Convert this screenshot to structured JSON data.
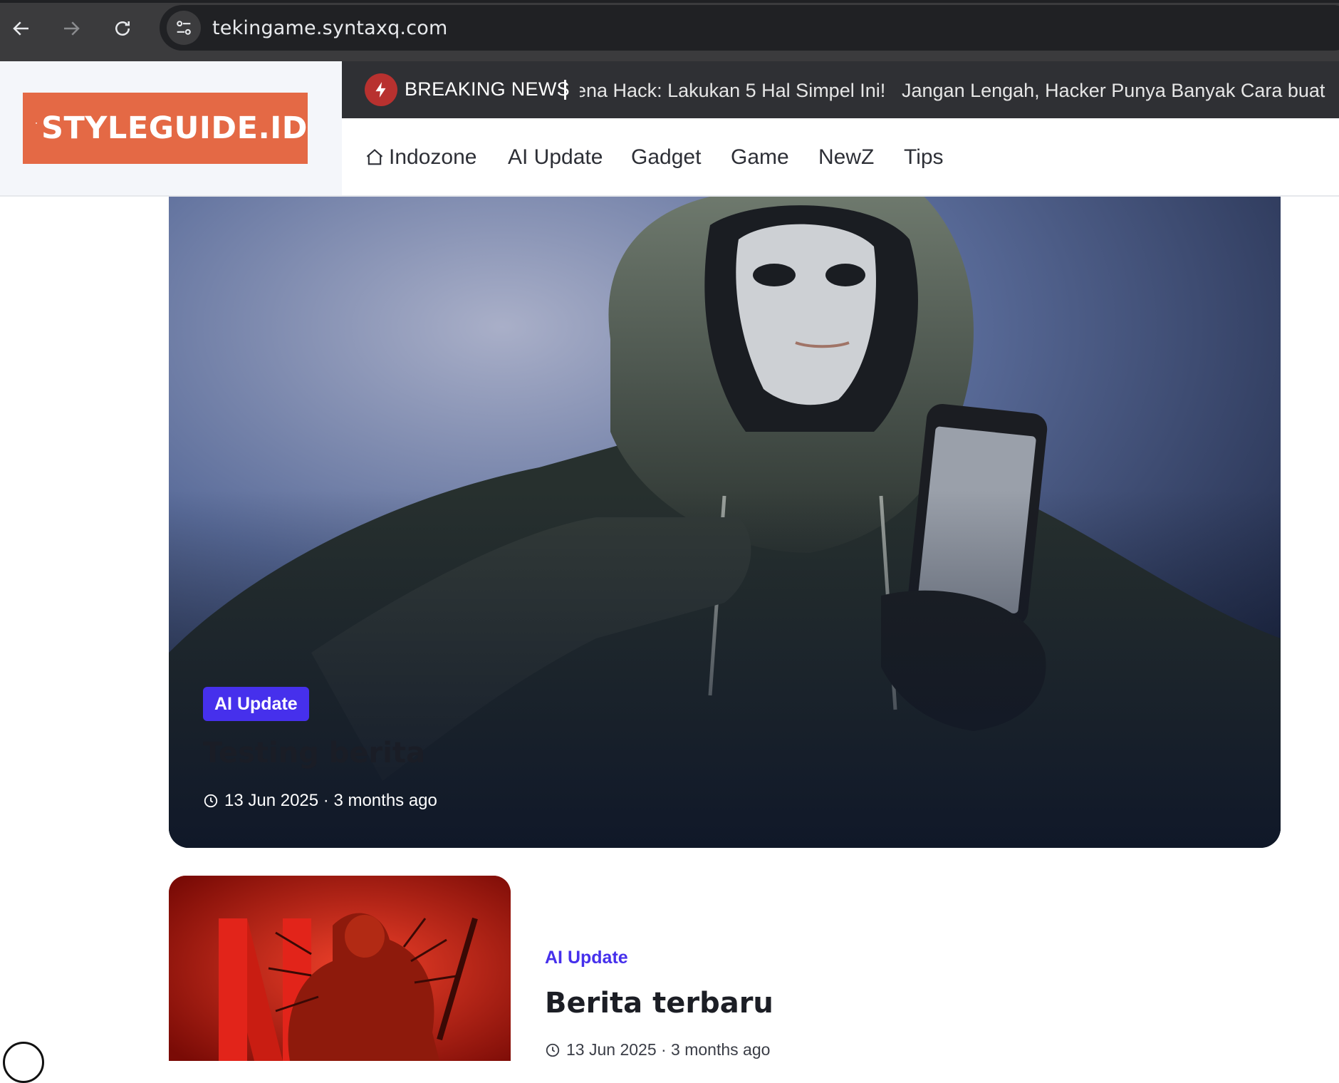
{
  "browser": {
    "url": "tekingame.syntaxq.com",
    "icons": [
      "back-arrow-icon",
      "forward-arrow-icon",
      "reload-icon",
      "site-info-icon"
    ]
  },
  "site": {
    "logo_text": "STYLEGUIDE.ID",
    "brand_color": "#e46945",
    "accent_color": "#4630ec"
  },
  "ticker": {
    "label": "BREAKING NEWS",
    "items": [
      "ena Hack: Lakukan 5 Hal Simpel Ini!",
      "Jangan Lengah, Hacker Punya Banyak Cara buat"
    ]
  },
  "menu": {
    "items": [
      "Indozone",
      "AI Update",
      "Gadget",
      "Game",
      "NewZ",
      "Tips"
    ]
  },
  "hero": {
    "category": "AI Update",
    "title": "Testing berita",
    "meta": "13 Jun 2025 · 3 months ago"
  },
  "article2": {
    "category": "AI Update",
    "title": "Berita terbaru",
    "meta": "13 Jun 2025 · 3 months ago"
  }
}
